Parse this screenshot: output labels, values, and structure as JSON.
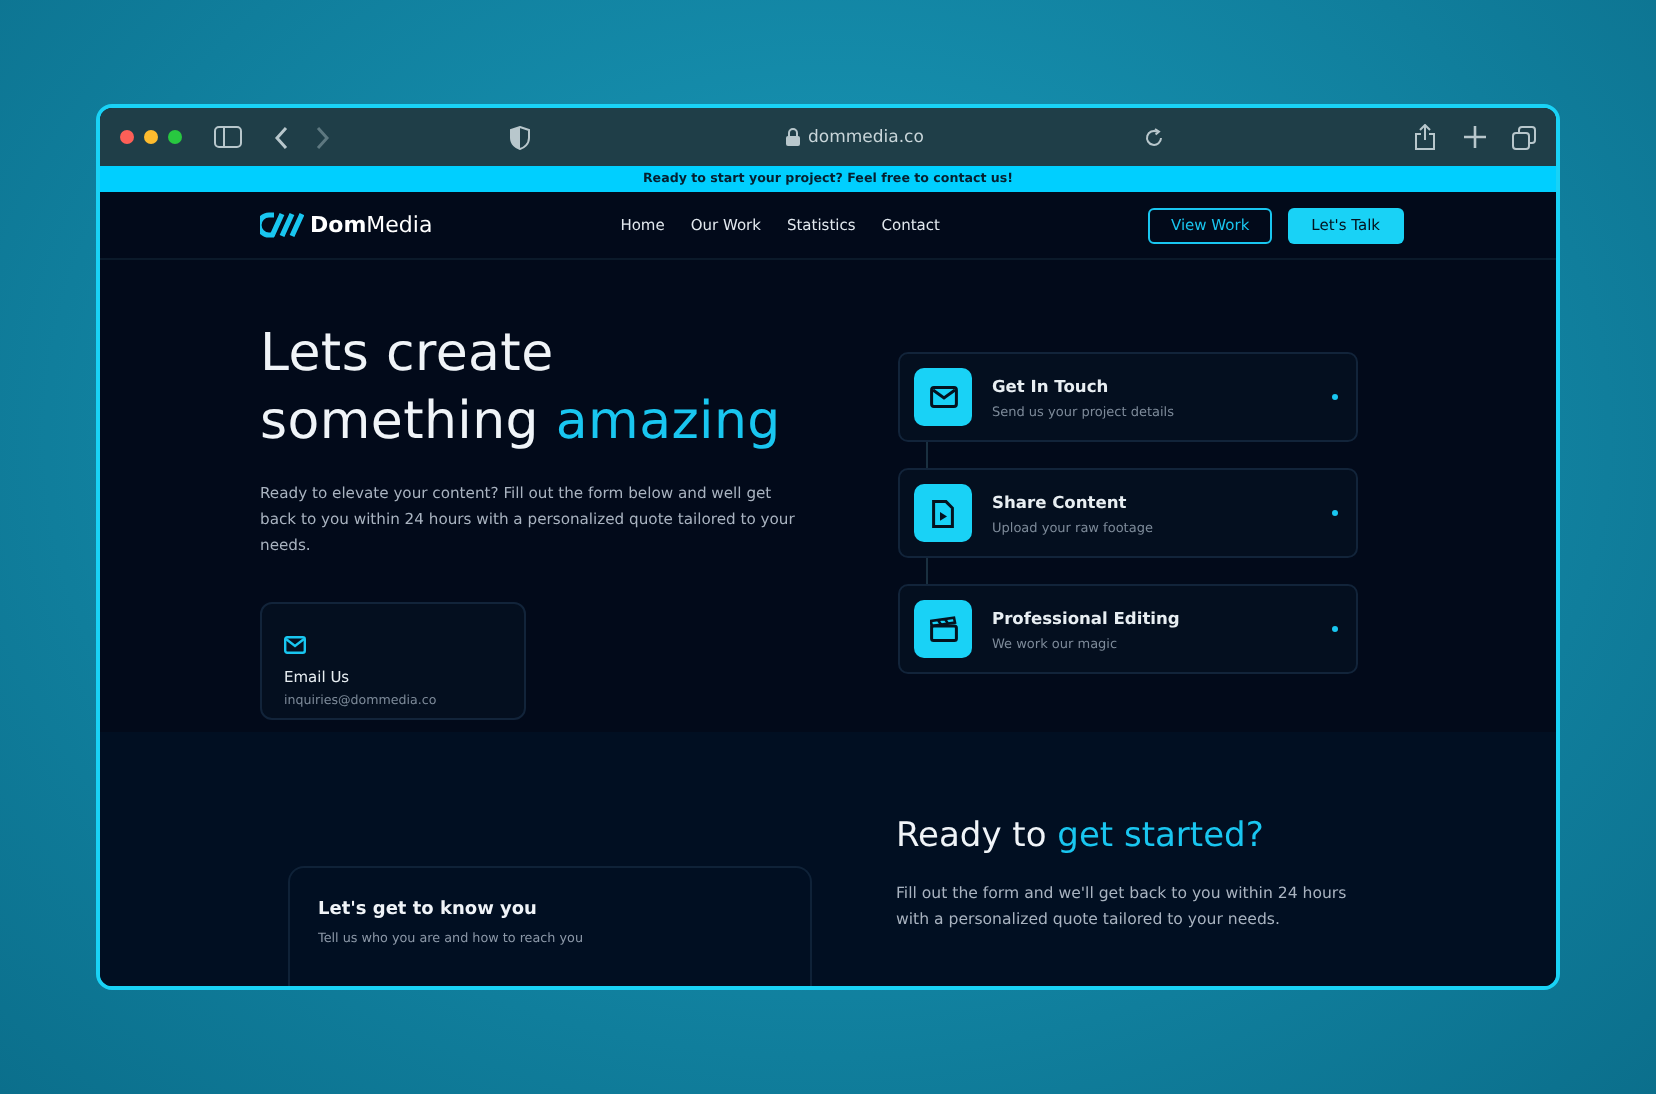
{
  "browser": {
    "url": "dommedia.co"
  },
  "banner": {
    "text": "Ready to start your project? Feel free to contact us!"
  },
  "nav": {
    "logo_bold": "Dom",
    "logo_rest": "Media",
    "links": [
      "Home",
      "Our Work",
      "Statistics",
      "Contact"
    ],
    "outline_button": "View Work",
    "primary_button": "Let's Talk"
  },
  "hero": {
    "title_line1": "Lets create",
    "title_line2": "something",
    "title_accent": "amazing",
    "text": "Ready to elevate your content? Fill out the form below and well get back to you within 24 hours with a personalized quote tailored to your needs.",
    "email_card": {
      "label": "Email Us",
      "value": "inquiries@dommedia.co"
    }
  },
  "steps": [
    {
      "kind": "mail",
      "title": "Get In Touch",
      "subtitle": "Send us your project details"
    },
    {
      "kind": "file",
      "title": "Share Content",
      "subtitle": "Upload your raw footage"
    },
    {
      "kind": "clapper",
      "title": "Professional Editing",
      "subtitle": "We work our magic"
    }
  ],
  "form_card": {
    "title": "Let's get to know you",
    "subtitle": "Tell us who you are and how to reach you"
  },
  "cta": {
    "title": "Ready to",
    "title_accent": "get started?",
    "text": "Fill out the form and we'll get back to you within 24 hours with a personalized quote tailored to your needs."
  }
}
